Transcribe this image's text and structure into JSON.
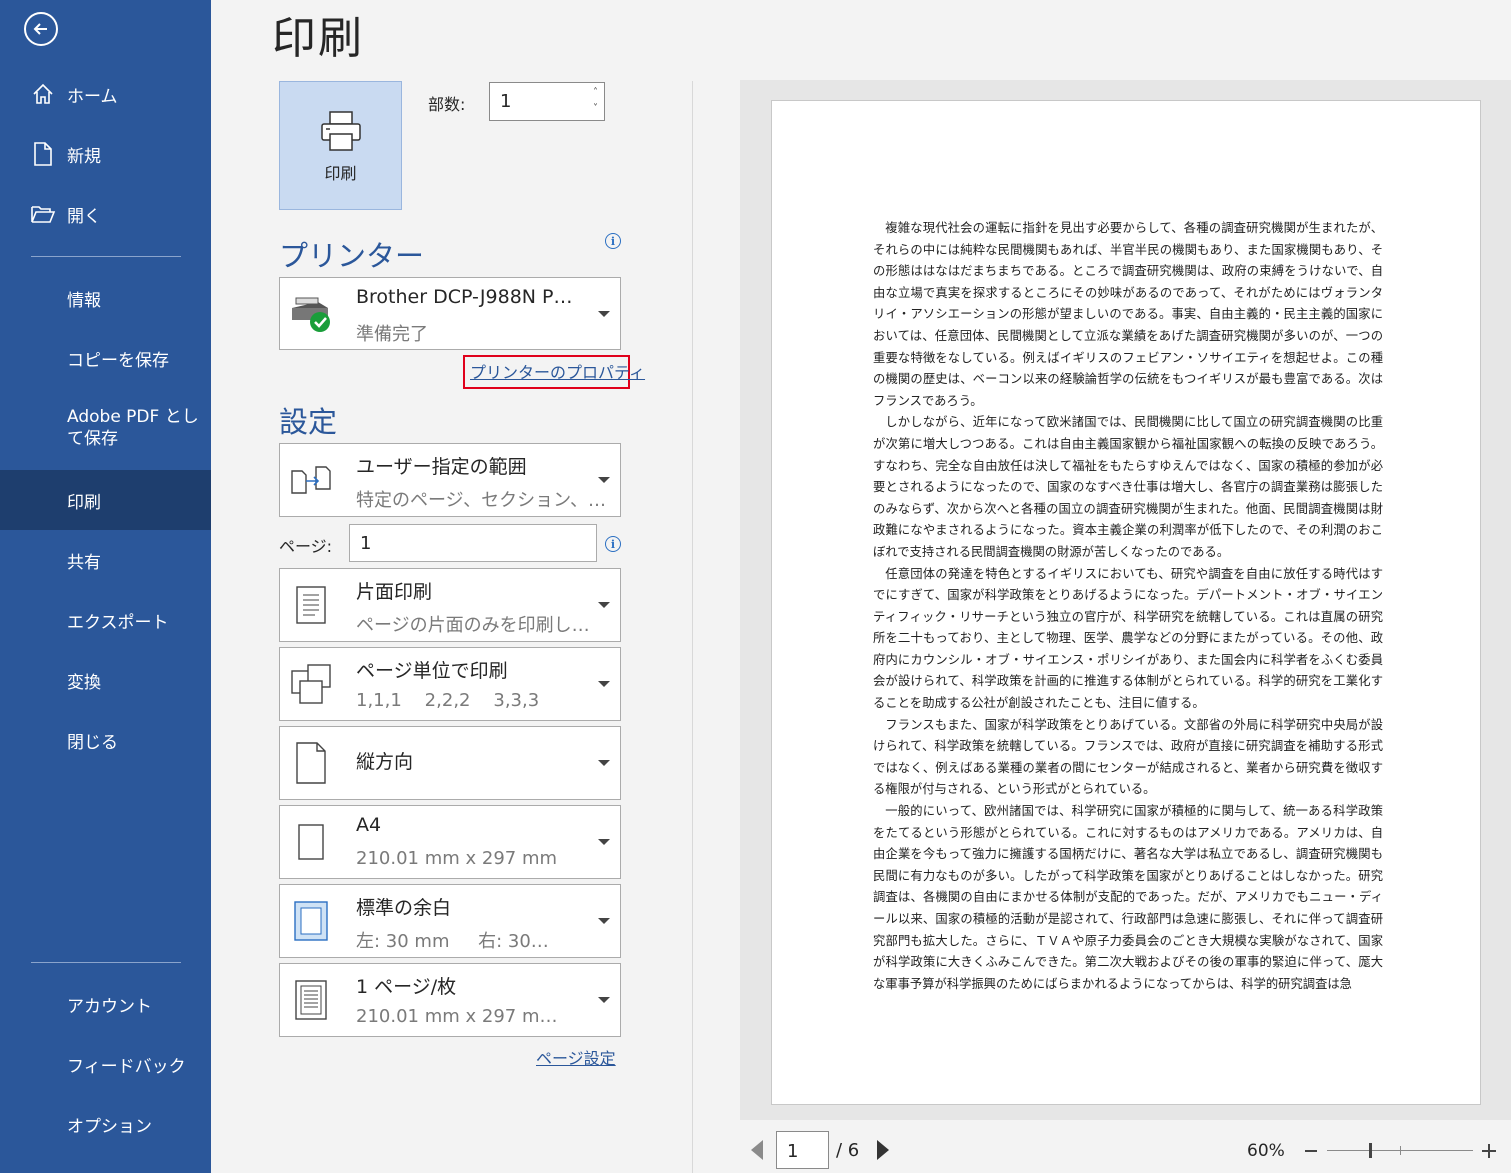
{
  "sidebar": {
    "items": [
      {
        "label": "ホーム",
        "icon": "home-icon"
      },
      {
        "label": "新規",
        "icon": "new-doc-icon"
      },
      {
        "label": "開く",
        "icon": "folder-open-icon"
      },
      {
        "label": "情報"
      },
      {
        "label": "コピーを保存"
      },
      {
        "label": "Adobe PDF として保存"
      },
      {
        "label": "印刷"
      },
      {
        "label": "共有"
      },
      {
        "label": "エクスポート"
      },
      {
        "label": "変換"
      },
      {
        "label": "閉じる"
      },
      {
        "label": "アカウント"
      },
      {
        "label": "フィードバック"
      },
      {
        "label": "オプション"
      }
    ],
    "active": "印刷",
    "accent": "#2b579a",
    "active_color": "#1e3e6e"
  },
  "main": {
    "title": "印刷",
    "print_button_label": "印刷",
    "copies_label": "部数:",
    "copies_value": "1",
    "printer_heading": "プリンター",
    "printer_name": "Brother DCP-J988N P…",
    "printer_status": "準備完了",
    "printer_properties_link": "プリンターのプロパティ",
    "settings_heading": "設定",
    "range": {
      "title": "ユーザー指定の範囲",
      "subtitle": "特定のページ、セクション、…"
    },
    "pages_label": "ページ:",
    "pages_value": "1",
    "sides": {
      "title": "片面印刷",
      "subtitle": "ページの片面のみを印刷し…"
    },
    "collate": {
      "title": "ページ単位で印刷",
      "subtitle": "1,1,1    2,2,2    3,3,3"
    },
    "orientation": {
      "title": "縦方向"
    },
    "paper": {
      "title": "A4",
      "subtitle": "210.01 mm x 297 mm"
    },
    "margins": {
      "title": "標準の余白",
      "subtitle": "左: 30 mm     右: 30…"
    },
    "pages_per_sheet": {
      "title": "1 ページ/枚",
      "subtitle": "210.01 mm x 297 m…"
    },
    "page_setup_link": "ページ設定",
    "highlight_color": "#e0001b"
  },
  "preview": {
    "paragraphs": [
      "複雑な現代社会の運転に指針を見出す必要からして、各種の調査研究機関が生まれたが、それらの中には純粋な民間機関もあれば、半官半民の機関もあり、また国家機関もあり、その形態ははなはだまちまちである。ところで調査研究機関は、政府の束縛をうけないで、自由な立場で真実を探求するところにその妙味があるのであって、それがためにはヴォランタリイ・アソシエーションの形態が望ましいのである。事実、自由主義的・民主主義的国家においては、任意団体、民間機関として立派な業績をあげた調査研究機関が多いのが、一つの重要な特徴をなしている。例えばイギリスのフェビアン・ソサイエティを想起せよ。この種の機関の歴史は、ベーコン以来の経験論哲学の伝統をもつイギリスが最も豊富である。次はフランスであろう。",
      "しかしながら、近年になって欧米諸国では、民間機関に比して国立の研究調査機関の比重が次第に増大しつつある。これは自由主義国家観から福祉国家観への転換の反映であろう。すなわち、完全な自由放任は決して福祉をもたらすゆえんではなく、国家の積極的参加が必要とされるようになったので、国家のなすべき仕事は増大し、各官庁の調査業務は膨張したのみならず、次から次へと各種の国立の調査研究機関が生まれた。他面、民間調査機関は財政難になやまされるようになった。資本主義企業の利潤率が低下したので、その利潤のおこぼれで支持される民間調査機関の財源が苦しくなったのである。",
      "任意団体の発達を特色とするイギリスにおいても、研究や調査を自由に放任する時代はすでにすぎて、国家が科学政策をとりあげるようになった。デパートメント・オブ・サイエンティフィック・リサーチという独立の官庁が、科学研究を統轄している。これは直属の研究所を二十もっており、主として物理、医学、農学などの分野にまたがっている。その他、政府内にカウンシル・オブ・サイエンス・ポリシイがあり、また国会内に科学者をふくむ委員会が設けられて、科学政策を計画的に推進する体制がとられている。科学的研究を工業化することを助成する公社が創設されたことも、注目に値する。",
      "フランスもまた、国家が科学政策をとりあげている。文部省の外局に科学研究中央局が設けられて、科学政策を統轄している。フランスでは、政府が直接に研究調査を補助する形式ではなく、例えばある業種の業者の間にセンターが結成されると、業者から研究費を徴収する権限が付与される、という形式がとられている。",
      "一般的にいって、欧州諸国では、科学研究に国家が積極的に関与して、統一ある科学政策をたてるという形態がとられている。これに対するものはアメリカである。アメリカは、自由企業を今もって強力に擁護する国柄だけに、著名な大学は私立であるし、調査研究機関も民間に有力なものが多い。したがって科学政策を国家がとりあげることはしなかった。研究調査は、各機関の自由にまかせる体制が支配的であった。だが、アメリカでもニュー・ディール以来、国家の積極的活動が是認されて、行政部門は急速に膨張し、それに伴って調査研究部門も拡大した。さらに、ＴＶＡや原子力委員会のごとき大規模な実験がなされて、国家が科学政策に大きくふみこんできた。第二次大戦およびその後の軍事的緊迫に伴って、厖大な軍事予算が科学振興のためにばらまかれるようになってからは、科学的研究調査は急"
    ]
  },
  "footer": {
    "current_page": "1",
    "total_pages": "/ 6",
    "zoom": "60%",
    "zoom_level_percent": 60
  }
}
